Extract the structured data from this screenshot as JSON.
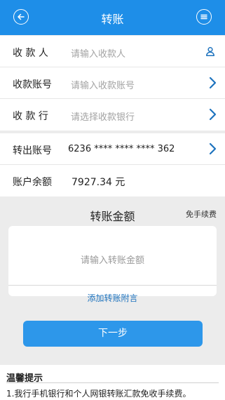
{
  "header": {
    "title": "转账",
    "back_icon": "back-arrow-icon",
    "menu_icon": "menu-icon",
    "background_color": "#1e8ee8"
  },
  "payee": {
    "rows": [
      {
        "label": "收 款 人",
        "placeholder": "请输入收款人",
        "icon": "contact-person-icon"
      },
      {
        "label": "收款账号",
        "placeholder": "请输入收款账号",
        "icon": "chevron-right-icon"
      },
      {
        "label": "收 款 行",
        "placeholder": "请选择收款银行",
        "icon": "chevron-right-icon"
      }
    ]
  },
  "payer": {
    "account_label": "转出账号",
    "account_value": "6236 **** **** **** 362",
    "balance_label": "账户余额",
    "balance_value": "7927.34  元"
  },
  "amount": {
    "title": "转账金额",
    "fee_note": "免手续费",
    "placeholder": "请输入转账金额",
    "remark_link": "添加转账附言"
  },
  "next_button": {
    "label": "下一步",
    "color": "#2d97ea"
  },
  "tips": {
    "title": "温馨提示",
    "items": [
      "1.我行手机银行和个人网银转账汇款免收手续费。"
    ]
  }
}
